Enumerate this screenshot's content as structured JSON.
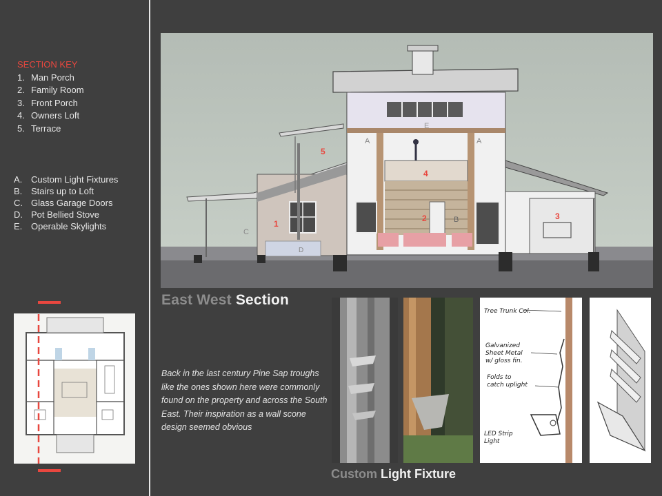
{
  "section_key": {
    "title": "SECTION  KEY",
    "items": [
      {
        "num": "1.",
        "label": "Man Porch"
      },
      {
        "num": "2.",
        "label": "Family Room"
      },
      {
        "num": "3.",
        "label": "Front Porch"
      },
      {
        "num": "4.",
        "label": "Owners Loft"
      },
      {
        "num": "5.",
        "label": "Terrace"
      }
    ]
  },
  "features": [
    {
      "letter": "A.",
      "label": "Custom Light Fixtures"
    },
    {
      "letter": "B.",
      "label": "Stairs up to Loft"
    },
    {
      "letter": "C.",
      "label": "Glass Garage Doors"
    },
    {
      "letter": "D.",
      "label": "Pot Bellied Stove"
    },
    {
      "letter": "E.",
      "label": "Operable Skylights"
    }
  ],
  "section_title": {
    "part1": "East West",
    "part2": " Section"
  },
  "section_marks": {
    "m1": "1",
    "m2": "2",
    "m3": "3",
    "m4": "4",
    "m5": "5",
    "a1": "A",
    "a2": "A",
    "b": "B",
    "c": "C",
    "d": "D",
    "e": "E"
  },
  "description": "Back in the last century Pine Sap troughs like the ones shown here were commonly found on the property and across the South East. Their inspiration as a wall scone design seemed obvious",
  "sketch_notes": {
    "n1": "Tree Trunk Col.",
    "n2a": "Galvanized",
    "n2b": "Sheet Metal",
    "n2c": "w/ gloss fin.",
    "n3a": "Folds to",
    "n3b": "catch uplight",
    "n4a": "LED Strip",
    "n4b": "Light"
  },
  "caption": {
    "part1": "Custom",
    "part2": " Light Fixture"
  },
  "colors": {
    "background": "#3f3f3f",
    "accent_red": "#e8473f",
    "label_grey": "#8c8c8c",
    "text_light": "#e6e6e6"
  }
}
